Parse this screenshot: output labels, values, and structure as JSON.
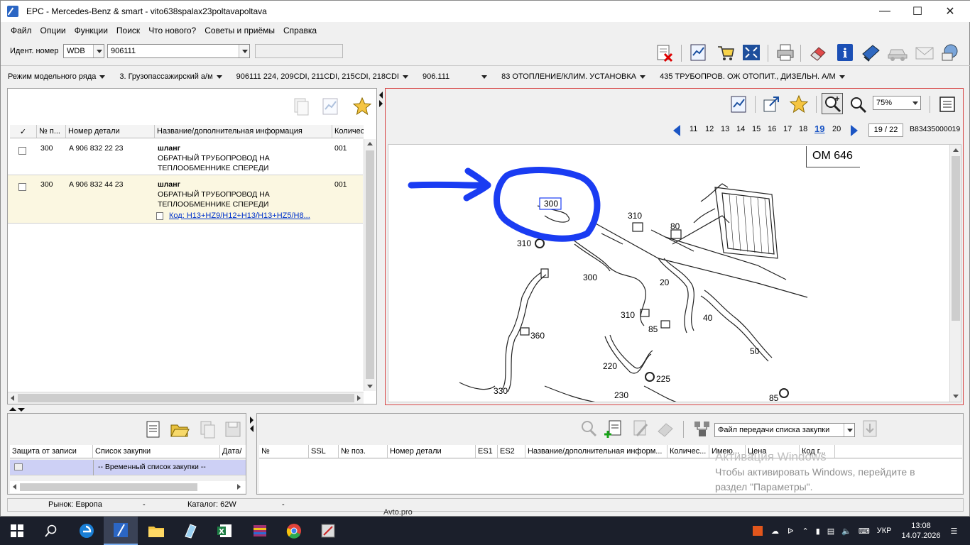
{
  "window": {
    "title": "EPC - Mercedes-Benz & smart - vito638spalax23poltavapoltava"
  },
  "menu": [
    "Файл",
    "Опции",
    "Функции",
    "Поиск",
    "Что нового?",
    "Советы и приёмы",
    "Справка"
  ],
  "ident": {
    "label": "Идент. номер",
    "prefix": "WDB",
    "number": "906111"
  },
  "breadcrumbs": [
    "Режим модельного ряда",
    "3. Грузопассажирский а/м",
    "906111 224, 209CDI, 211CDI, 215CDI, 218CDI",
    "906.111",
    "83 ОТОПЛЕНИЕ/КЛИМ. УСТАНОВКА",
    "435 ТРУБОПРОВ. ОЖ ОТОПИТ., ДИЗЕЛЬН. А/М"
  ],
  "parts_grid": {
    "headers": [
      "✓",
      "№ п...",
      "Номер детали",
      "Название/дополнительная информация",
      "Количес"
    ],
    "rows": [
      {
        "pos": "300",
        "number": "A 906 832 22 23",
        "name": "шланг",
        "info1": "ОБРАТНЫЙ ТРУБОПРОВОД НА",
        "info2": "ТЕПЛООБМЕННИКЕ СПЕРЕДИ",
        "qty": "001",
        "code": ""
      },
      {
        "pos": "300",
        "number": "A 906 832 44 23",
        "name": "шланг",
        "info1": "ОБРАТНЫЙ ТРУБОПРОВОД НА",
        "info2": "ТЕПЛООБМЕННИКЕ СПЕРЕДИ",
        "qty": "001",
        "code": "Код: H13+HZ9/H12+H13/H13+HZ5/H8..."
      }
    ]
  },
  "image_viewer": {
    "zoom": "75%",
    "pages": [
      "11",
      "12",
      "13",
      "14",
      "15",
      "16",
      "17",
      "18",
      "19",
      "20"
    ],
    "current_page": "19",
    "page_counter": "19 / 22",
    "image_id": "B83435000019",
    "engine_label": "OM 646",
    "callouts": [
      "300",
      "310",
      "80",
      "310",
      "300",
      "20",
      "310",
      "40",
      "85",
      "360",
      "50",
      "220",
      "225",
      "330",
      "230",
      "85"
    ]
  },
  "shopping": {
    "headers": [
      "Защита от записи",
      "Список закупки",
      "Дата/"
    ],
    "temp_list": "-- Временный список закупки --",
    "transfer_file": "Файл передачи списка закупки",
    "cart_headers": [
      "№",
      "SSL",
      "№ поз.",
      "Номер детали",
      "ES1",
      "ES2",
      "Название/дополнительная информ...",
      "Количес...",
      "Имею...",
      "Цена",
      "Код г..."
    ]
  },
  "status": {
    "market": "Рынок: Европа",
    "dash1": "-",
    "catalog": "Каталог: 62W",
    "dash2": "-"
  },
  "watermark": {
    "line1": "Активация Windows",
    "line2": "Чтобы активировать Windows, перейдите в",
    "line3": "раздел \"Параметры\"."
  },
  "background_tab": "Avto.pro",
  "tray": {
    "lang": "УКР",
    "time": "13:08",
    "date": "14.07.2026"
  },
  "colors": {
    "highlight_row": "#fbf7e1",
    "link": "#0033cc",
    "annotation": "#1a3cf2",
    "viewer_border": "#d64545"
  }
}
